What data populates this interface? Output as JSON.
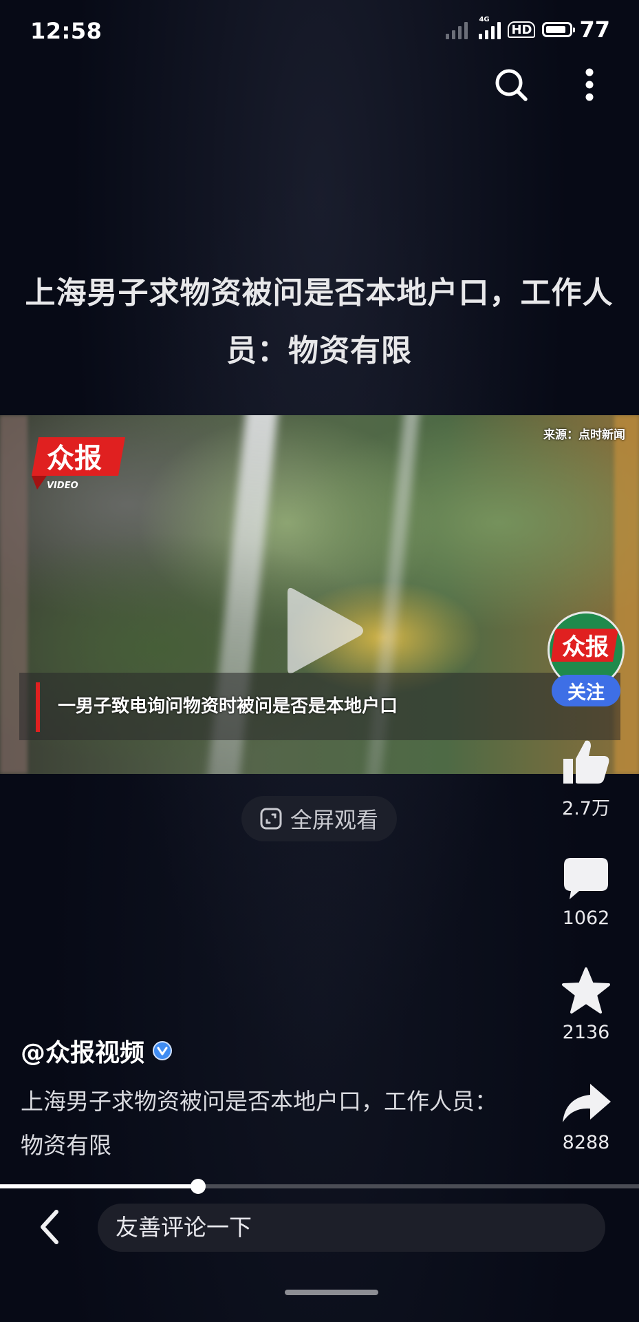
{
  "status_bar": {
    "time": "12:58",
    "network_type": "4G",
    "hd_label": "HD",
    "battery_level": "77"
  },
  "top_actions": {
    "search_icon": "search-icon",
    "more_icon": "more-vertical-icon"
  },
  "title": "上海男子求物资被问是否本地户口，工作人员：物资有限",
  "video": {
    "source_label": "来源：点时新闻",
    "logo_text": "众报",
    "logo_sub": "VIDEO",
    "subtitle": "一男子致电询问物资时被问是否是本地户口",
    "progress_fraction": 0.31
  },
  "fullscreen_button": {
    "label": "全屏观看"
  },
  "rail": {
    "follow_label": "关注",
    "avatar_text": "众报",
    "likes": "2.7万",
    "comments": "1062",
    "favorites": "2136",
    "shares": "8288"
  },
  "author": {
    "name": "@众报视频"
  },
  "caption": "上海男子求物资被问是否本地户口，工作人员：物资有限",
  "bottom_bar": {
    "comment_placeholder": "友善评论一下"
  },
  "colors": {
    "background": "#070a16",
    "follow_button": "#3e6fe6",
    "verified_badge": "#3f8cf2",
    "logo_red": "#e02020"
  }
}
